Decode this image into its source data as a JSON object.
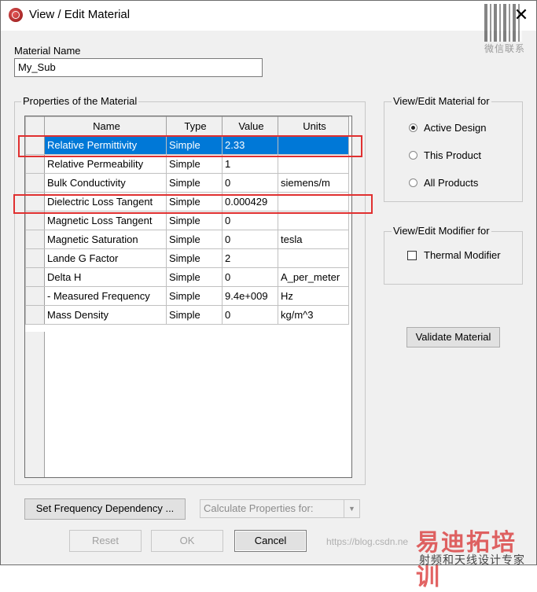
{
  "window": {
    "title": "View / Edit Material",
    "close_symbol": "✕"
  },
  "material_name": {
    "label": "Material Name",
    "value": "My_Sub"
  },
  "properties_group": {
    "title": "Properties of the Material",
    "columns": [
      "Name",
      "Type",
      "Value",
      "Units"
    ],
    "selected_row": 0,
    "rows": [
      {
        "name": "Relative Permittivity",
        "type": "Simple",
        "value": "2.33",
        "units": ""
      },
      {
        "name": "Relative Permeability",
        "type": "Simple",
        "value": "1",
        "units": ""
      },
      {
        "name": "Bulk Conductivity",
        "type": "Simple",
        "value": "0",
        "units": "siemens/m"
      },
      {
        "name": "Dielectric Loss Tangent",
        "type": "Simple",
        "value": "0.000429",
        "units": ""
      },
      {
        "name": "Magnetic Loss Tangent",
        "type": "Simple",
        "value": "0",
        "units": ""
      },
      {
        "name": "Magnetic Saturation",
        "type": "Simple",
        "value": "0",
        "units": "tesla"
      },
      {
        "name": "Lande G Factor",
        "type": "Simple",
        "value": "2",
        "units": ""
      },
      {
        "name": "Delta H",
        "type": "Simple",
        "value": "0",
        "units": "A_per_meter"
      },
      {
        "name": " -  Measured Frequency",
        "type": "Simple",
        "value": "9.4e+009",
        "units": "Hz"
      },
      {
        "name": "Mass Density",
        "type": "Simple",
        "value": "0",
        "units": "kg/m^3"
      }
    ]
  },
  "view_edit_material_for": {
    "title": "View/Edit Material for",
    "options": [
      {
        "label": "Active Design",
        "selected": true
      },
      {
        "label": "This Product",
        "selected": false
      },
      {
        "label": "All Products",
        "selected": false
      }
    ]
  },
  "view_edit_modifier_for": {
    "title": "View/Edit Modifier for",
    "thermal_modifier": {
      "label": "Thermal Modifier",
      "checked": false
    }
  },
  "buttons": {
    "validate": "Validate Material",
    "set_frequency": "Set Frequency Dependency ...",
    "reset": "Reset",
    "ok": "OK",
    "cancel": "Cancel"
  },
  "calculate_select": {
    "value": "Calculate Properties for:"
  },
  "overlay": {
    "qr_caption": "微信联系",
    "watermark_main": "易迪拓培训",
    "watermark_sub": "射频和天线设计专家",
    "blog_text": "https://blog.csdn.ne"
  },
  "colors": {
    "selection": "#0078d7",
    "highlight_box": "#e03030",
    "dialog_bg": "#f0f0f0"
  }
}
